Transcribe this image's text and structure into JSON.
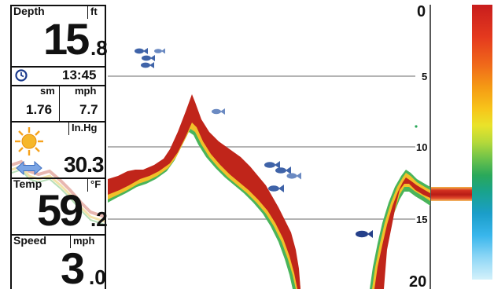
{
  "readouts": {
    "depth": {
      "label": "Depth",
      "unit": "ft",
      "value_int": "15",
      "value_dec": ".8"
    },
    "time": {
      "value": "13:45"
    },
    "distance": {
      "unit_left": "sm",
      "unit_right": "mph",
      "value_left": "1.76",
      "value_right": "7.7"
    },
    "pressure": {
      "unit": "In.Hg",
      "value": "30.3"
    },
    "temp": {
      "label": "Temp",
      "unit": "°F",
      "value_int": "59",
      "value_dec": ".2"
    },
    "speed": {
      "label": "Speed",
      "unit": "mph",
      "value_int": "3",
      "value_dec": ".0"
    }
  },
  "depth_scale": {
    "labels": [
      "0",
      "5",
      "10",
      "15",
      "20"
    ]
  },
  "icons": {
    "clock": "clock-icon",
    "sun": "sun-icon",
    "trend": "double-arrow-icon",
    "fish": "fish-icon"
  },
  "colors": {
    "bottom_strong": "#c0251a",
    "bottom_mid": "#f2a51e",
    "bottom_weak": "#49b45a",
    "fish": "#3f63a8",
    "sun": "#f6a21c",
    "arrow": "#5f8fd6"
  }
}
